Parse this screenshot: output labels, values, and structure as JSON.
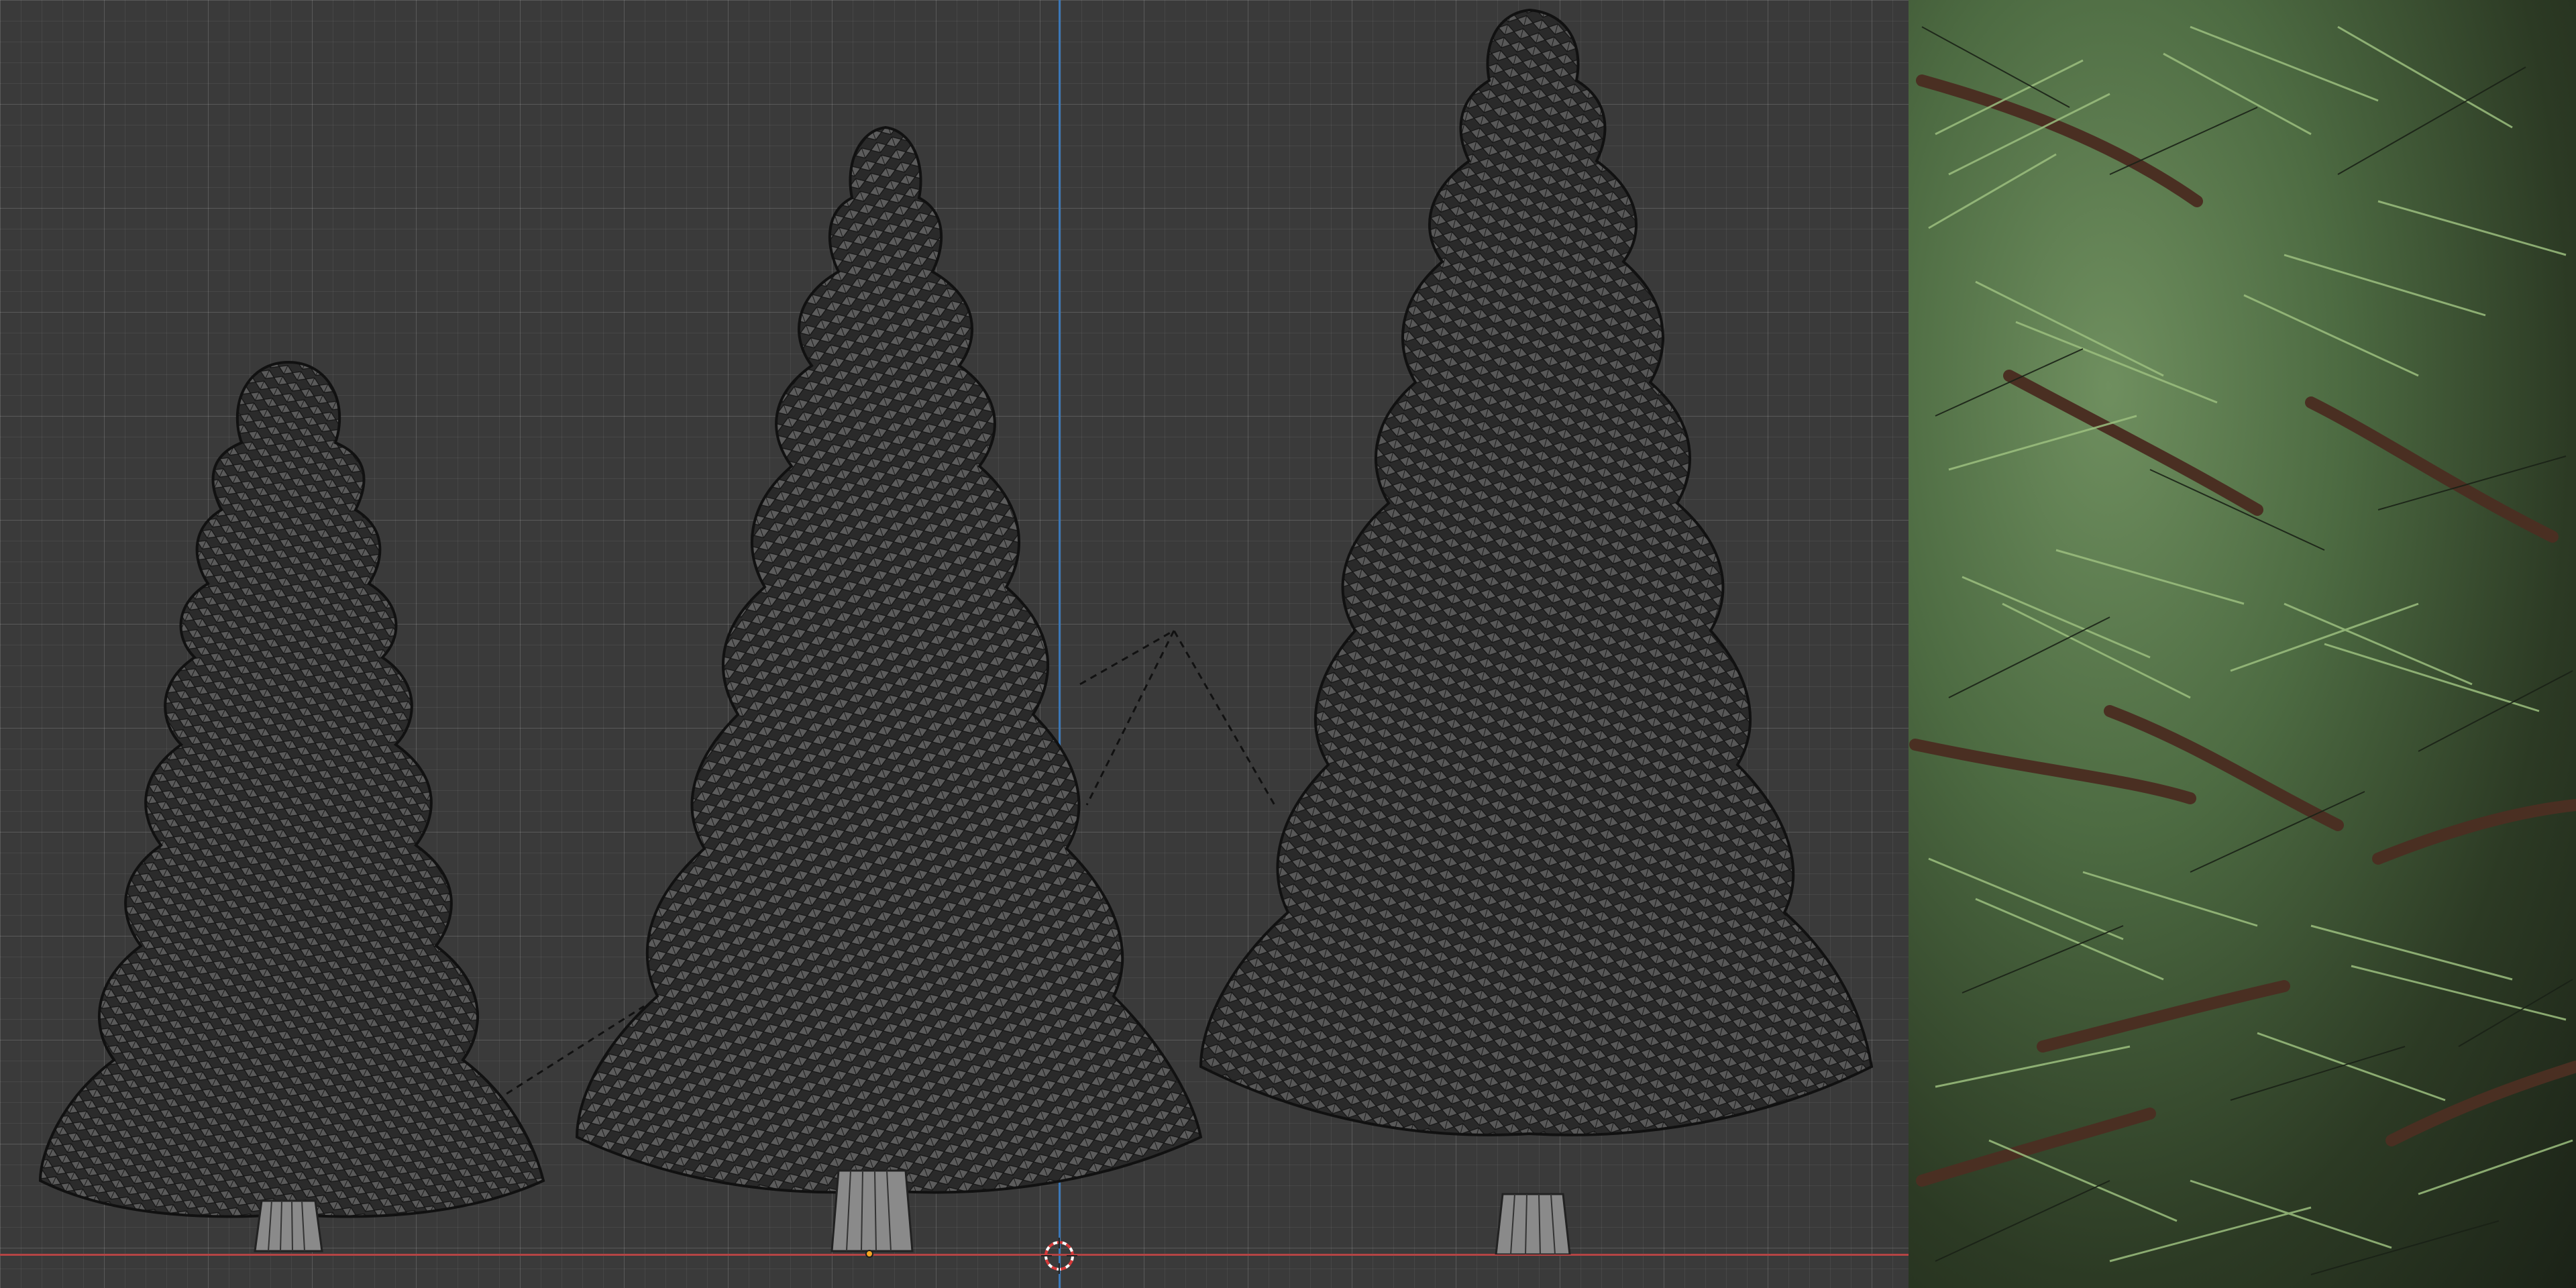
{
  "viewport": {
    "background_color": "#3a3a3a",
    "x_axis_color": "#b44444",
    "y_axis_color": "#3b78b8",
    "objects": [
      {
        "name": "spruce-tree-small",
        "type": "tree"
      },
      {
        "name": "spruce-tree-medium",
        "type": "tree"
      },
      {
        "name": "spruce-tree-large",
        "type": "tree"
      }
    ],
    "cursor_icon": "3d-cursor-icon",
    "origin_icon": "object-origin-icon"
  },
  "texture_preview": {
    "name": "needle-texture-preview",
    "colors": {
      "light_needle": "#9cbf7f",
      "mid_needle": "#5e7d4d",
      "dark": "#1a2116",
      "branch": "#4a2f22"
    }
  }
}
